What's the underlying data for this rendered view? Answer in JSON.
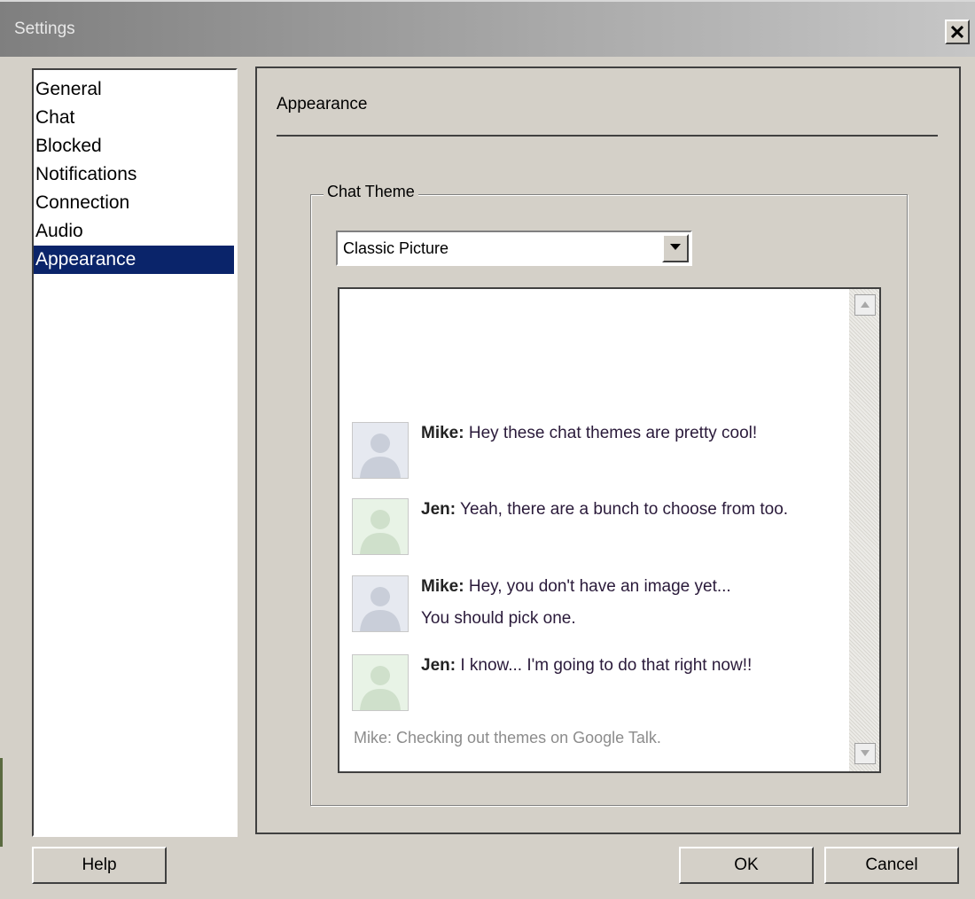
{
  "window": {
    "title": "Settings",
    "close_label": "✕"
  },
  "sidebar": {
    "items": [
      {
        "label": "General",
        "selected": false
      },
      {
        "label": "Chat",
        "selected": false
      },
      {
        "label": "Blocked",
        "selected": false
      },
      {
        "label": "Notifications",
        "selected": false
      },
      {
        "label": "Connection",
        "selected": false
      },
      {
        "label": "Audio",
        "selected": false
      },
      {
        "label": "Appearance",
        "selected": true
      }
    ]
  },
  "panel": {
    "heading": "Appearance",
    "chat_theme": {
      "legend": "Chat Theme",
      "selected_theme": "Classic Picture",
      "preview": {
        "messages": [
          {
            "sender": "Mike:",
            "text": "Hey these chat themes are pretty cool!",
            "extra": "",
            "avatar": "gray"
          },
          {
            "sender": "Jen:",
            "text": "Yeah, there are a bunch to choose from too.",
            "extra": "",
            "avatar": "green"
          },
          {
            "sender": "Mike:",
            "text": "Hey, you don't have an image yet...",
            "extra": "You should pick one.",
            "avatar": "gray"
          },
          {
            "sender": "Jen:",
            "text": "I know... I'm going to do that right now!!",
            "extra": "",
            "avatar": "green"
          }
        ],
        "status_line": "Mike: Checking out themes on Google Talk."
      }
    }
  },
  "buttons": {
    "help": "Help",
    "ok": "OK",
    "cancel": "Cancel"
  },
  "colors": {
    "selection": "#0a246a",
    "dialog_background": "#d4d0c8",
    "status_text": "#8c8c8c"
  }
}
